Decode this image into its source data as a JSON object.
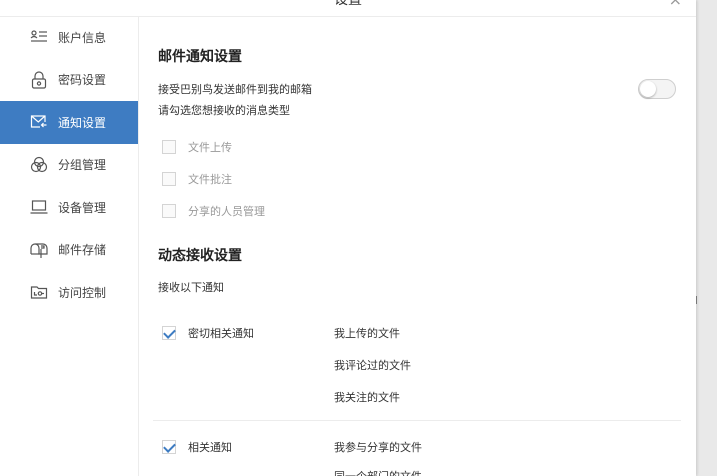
{
  "window": {
    "title": "设置",
    "close_glyph": "×"
  },
  "sidebar": {
    "items": [
      {
        "label": "账户信息",
        "icon": "account-info-icon"
      },
      {
        "label": "密码设置",
        "icon": "lock-icon"
      },
      {
        "label": "通知设置",
        "icon": "notification-mail-icon",
        "active": true
      },
      {
        "label": "分组管理",
        "icon": "group-icon"
      },
      {
        "label": "设备管理",
        "icon": "laptop-icon"
      },
      {
        "label": "邮件存储",
        "icon": "mailbox-storage-icon"
      },
      {
        "label": "访问控制",
        "icon": "access-control-icon"
      }
    ]
  },
  "email_section": {
    "title": "邮件通知设置",
    "receive_label": "接受巴别鸟发送邮件到我的邮箱",
    "toggle_on": false,
    "choose_label": "请勾选您想接收的消息类型",
    "options": [
      {
        "label": "文件上传",
        "checked": false
      },
      {
        "label": "文件批注",
        "checked": false
      },
      {
        "label": "分享的人员管理",
        "checked": false
      }
    ]
  },
  "dynamic_section": {
    "title": "动态接收设置",
    "subtitle": "接收以下通知",
    "groups": [
      {
        "label": "密切相关通知",
        "checked": true,
        "items": [
          "我上传的文件",
          "我评论过的文件",
          "我关注的文件"
        ]
      },
      {
        "label": "相关通知",
        "checked": true,
        "items": [
          "我参与分享的文件",
          "同一个部门的文件"
        ]
      }
    ]
  },
  "colors": {
    "accent": "#3e7cc2",
    "divider": "#ececec"
  }
}
